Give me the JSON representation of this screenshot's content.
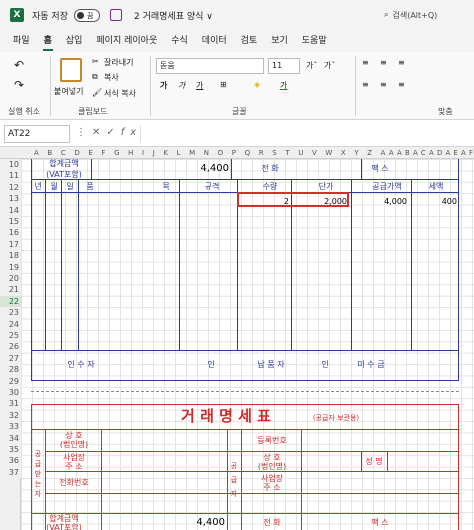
{
  "titlebar": {
    "app_logo": "X",
    "autosave_label": "자동 저장",
    "autosave_state": "끔",
    "doc_title": "2 거래명세표 양식 ∨",
    "search_placeholder": "검색(Alt+Q)"
  },
  "menu": [
    "파일",
    "홈",
    "삽입",
    "페이지 레이아웃",
    "수식",
    "데이터",
    "검토",
    "보기",
    "도움말"
  ],
  "ribbon": {
    "paste_label": "붙여넣기",
    "cut_label": "잘라내기",
    "copy_label": "복사",
    "format_painter_label": "서식 복사",
    "font_name": "돋움",
    "font_size": "11",
    "bold": "가",
    "italic": "가",
    "underline": "가",
    "groups": [
      "실행 취소",
      "클립보드",
      "글꼴",
      "맞춤"
    ]
  },
  "formula_bar": {
    "name_box": "AT22",
    "fx": "fx",
    "value": ""
  },
  "columns": "A B C D E F G H I J K L M N O P Q R S T U V W X Y Z AAABACADAEAFAGAHAI AJ",
  "rows": [
    "10",
    "11",
    "12",
    "13",
    "14",
    "15",
    "16",
    "17",
    "18",
    "19",
    "20",
    "21",
    "22",
    "23",
    "24",
    "25",
    "26",
    "27",
    "28",
    "29",
    "30",
    "31",
    "32",
    "33",
    "34",
    "35",
    "36",
    "37"
  ],
  "selected_row": "22",
  "top_form": {
    "total_label": "합계금액",
    "total_sublabel": "(VAT포함)",
    "total_value": "4,400",
    "phone_label": "전  화",
    "fax_label": "팩  스",
    "headers": [
      "년",
      "월",
      "일",
      "품",
      "목",
      "규격",
      "수량",
      "단가",
      "공급가액",
      "세액"
    ],
    "item_row": {
      "qty": "2",
      "price": "2,000",
      "supply": "4,000",
      "tax": "400"
    },
    "footer": [
      "인  수  자",
      "인",
      "납  품  자",
      "인",
      "미  수  금"
    ]
  },
  "bottom_form": {
    "title": "거 래 명 세 표",
    "subtitle": "(공급자 보관용)",
    "receiver_label": "공급받는자",
    "supplier_label": "공급자",
    "name_label": "상  호",
    "name_sublabel": "(법인명)",
    "addr_label": "사업장",
    "addr_sublabel": "주  소",
    "phone_no_label": "전화번호",
    "reg_no_label": "등록번호",
    "name_label2": "상  호",
    "name_sublabel2": "(법인명)",
    "person_label": "성  명",
    "addr_label2": "사업장",
    "addr_sublabel2": "주  소",
    "total_label": "합계금액",
    "total_sublabel": "(VAT포함)",
    "total_value": "4,400",
    "phone_label": "전  화",
    "fax_label": "팩  스"
  }
}
